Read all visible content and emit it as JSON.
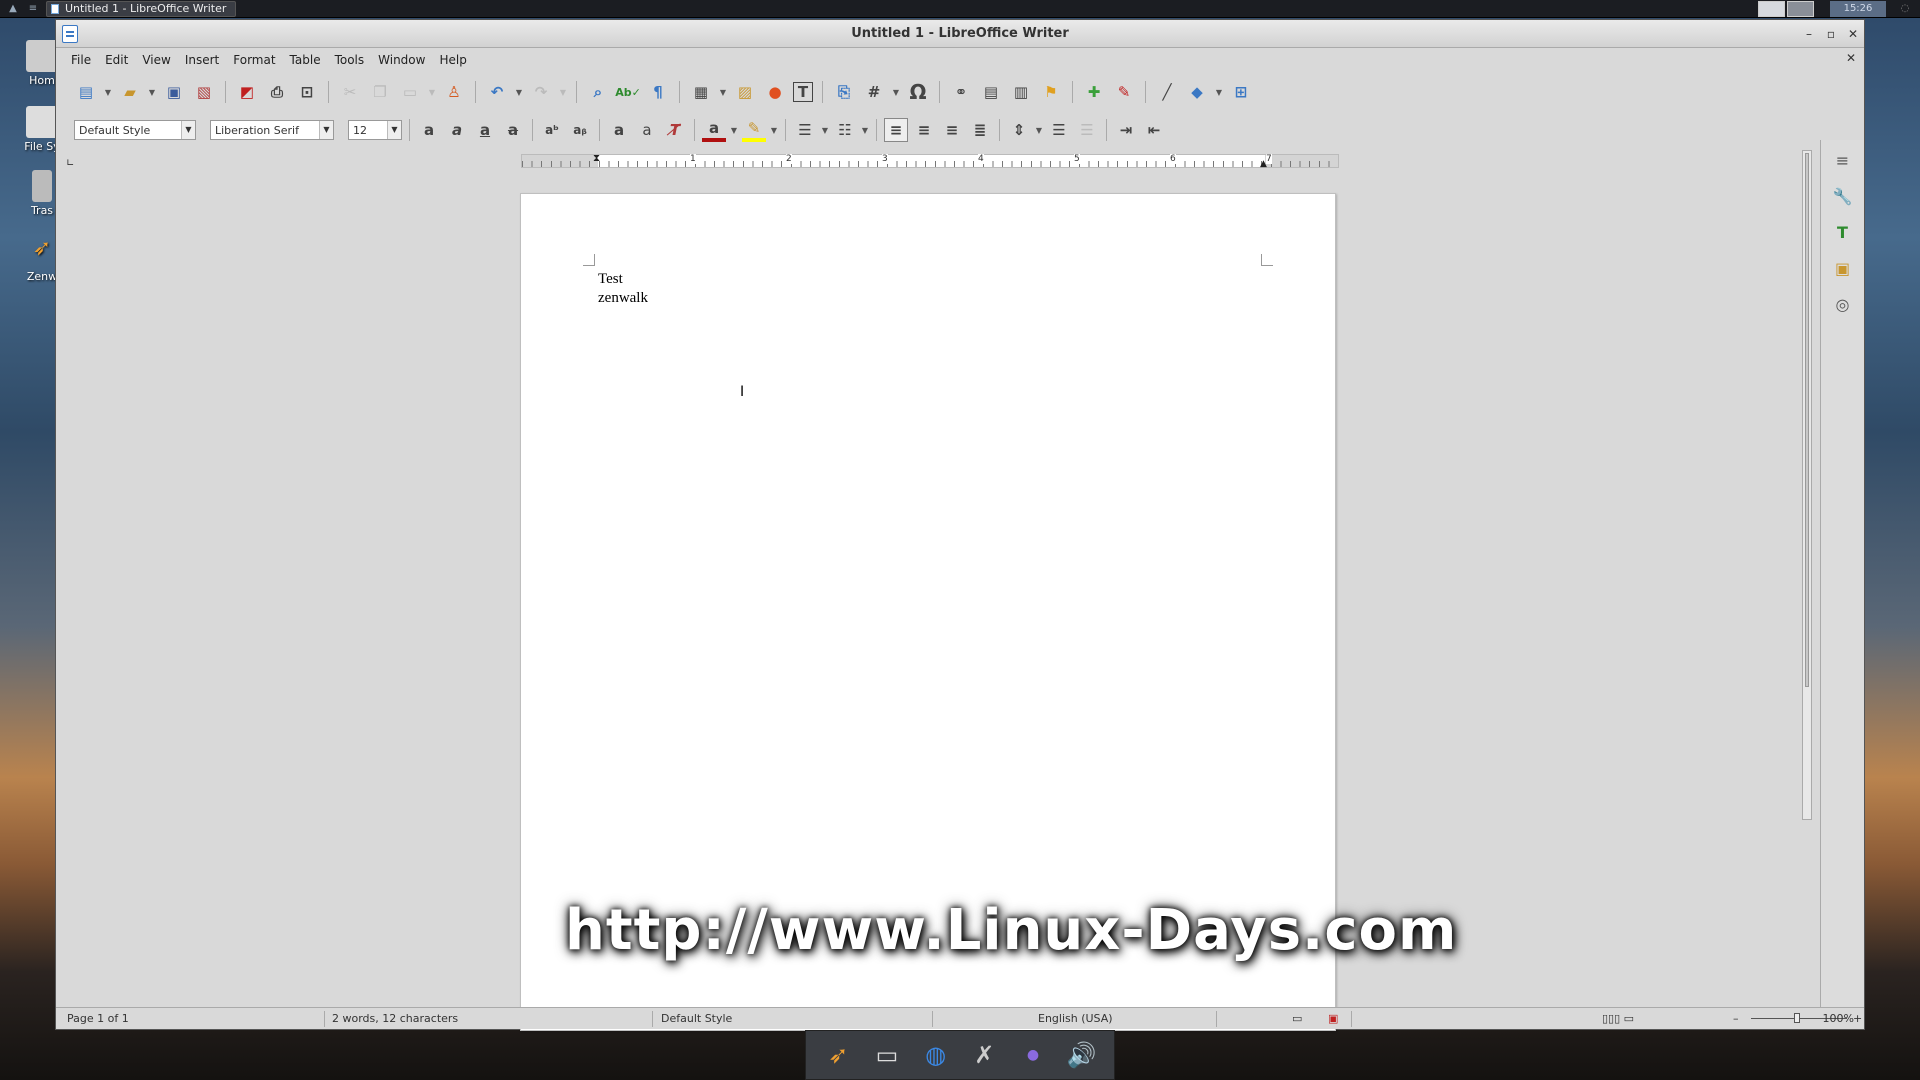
{
  "taskbar": {
    "task_label": "Untitled 1 - LibreOffice Writer",
    "clock": "15:26"
  },
  "desktop": {
    "icons": [
      "Hom",
      "File Sy",
      "Tras",
      "Zenw"
    ]
  },
  "window": {
    "title": "Untitled 1 - LibreOffice Writer"
  },
  "menu": [
    "File",
    "Edit",
    "View",
    "Insert",
    "Format",
    "Table",
    "Tools",
    "Window",
    "Help"
  ],
  "formatting": {
    "paragraph_style": "Default Style",
    "font_name": "Liberation Serif",
    "font_size": "12"
  },
  "ruler": {
    "numbers": [
      "1",
      "2",
      "3",
      "4",
      "5",
      "6",
      "7"
    ]
  },
  "document": {
    "lines": [
      "Test",
      "zenwalk"
    ]
  },
  "watermark": "http://www.Linux-Days.com",
  "status": {
    "page": "Page 1 of 1",
    "words": "2 words, 12 characters",
    "style": "Default Style",
    "language": "English (USA)",
    "zoom": "100%"
  },
  "colors": {
    "font_color": "#b01010",
    "highlight": "#ffff00",
    "accent": "#3b78c4"
  }
}
